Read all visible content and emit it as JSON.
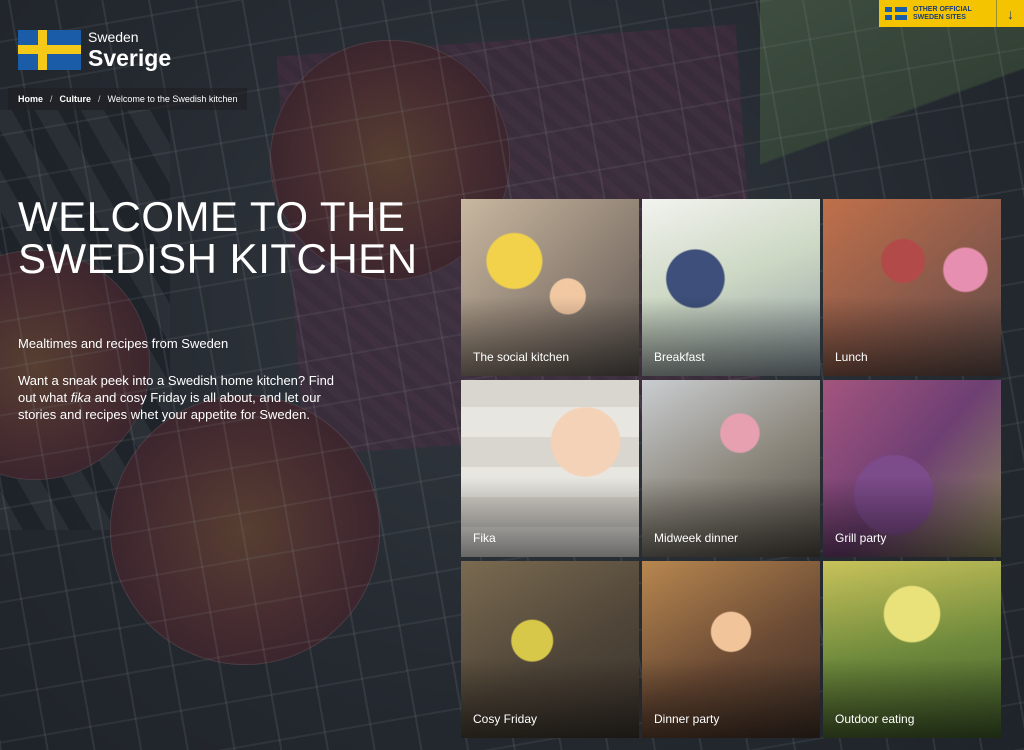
{
  "brand": {
    "logo_small": "Sweden",
    "logo_big": "Sverige",
    "flag_colors": {
      "blue": "#1a5ca8",
      "yellow": "#f4c918"
    }
  },
  "breadcrumb": {
    "items": [
      "Home",
      "Culture",
      "Welcome to the Swedish kitchen"
    ],
    "separator": "/"
  },
  "official_sites": {
    "label": "OTHER OFFICIAL SWEDEN SITES",
    "icon": "arrow-down-icon",
    "bg_color": "#f5c400"
  },
  "hero": {
    "title": "WELCOME TO THE SWEDISH KITCHEN",
    "subtitle": "Mealtimes and recipes from Sweden",
    "body_before": "Want a sneak peek into a Swedish home kitchen? Find out what ",
    "body_em": "fika",
    "body_after": " and cosy Friday is all about, and let our stories and recipes whet your appetite for Sweden."
  },
  "cards": [
    {
      "label": "The social kitchen"
    },
    {
      "label": "Breakfast"
    },
    {
      "label": "Lunch"
    },
    {
      "label": "Fika"
    },
    {
      "label": "Midweek dinner"
    },
    {
      "label": "Grill party"
    },
    {
      "label": "Cosy Friday"
    },
    {
      "label": "Dinner party"
    },
    {
      "label": "Outdoor eating"
    }
  ]
}
